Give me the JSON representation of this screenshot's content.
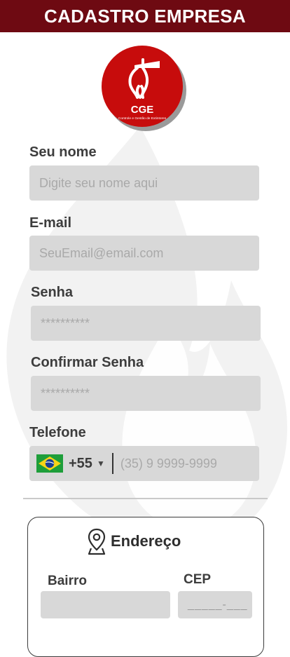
{
  "header": {
    "title": "CADASTRO EMPRESA"
  },
  "logo": {
    "text": "CGE",
    "subtitle": "Controle e Gestão de Extintores"
  },
  "form": {
    "name": {
      "label": "Seu nome",
      "placeholder": "Digite seu nome aqui"
    },
    "email": {
      "label": "E-mail",
      "placeholder": "SeuEmail@email.com"
    },
    "password": {
      "label": "Senha",
      "placeholder": "**********"
    },
    "confirm": {
      "label": "Confirmar Senha",
      "placeholder": "**********"
    },
    "phone": {
      "label": "Telefone",
      "country_code": "+55",
      "placeholder": "(35) 9 9999-9999"
    }
  },
  "address": {
    "title": "Endereço",
    "bairro_label": "Bairro",
    "cep_label": "CEP",
    "cep_placeholder": "_____-___"
  },
  "colors": {
    "header": "#6e0a12",
    "logo": "#c70c0c",
    "field": "#d8d8d8"
  },
  "icons": [
    "fire-extinguisher-icon",
    "brazil-flag-icon",
    "chevron-down-icon",
    "map-pin-icon"
  ]
}
